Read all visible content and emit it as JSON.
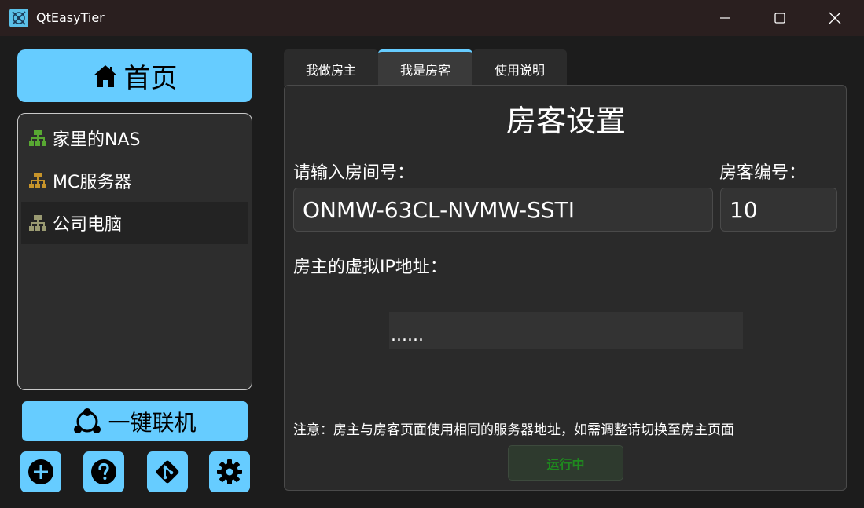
{
  "window": {
    "title": "QtEasyTier"
  },
  "sidebar": {
    "home_label": "首页",
    "devices": [
      {
        "label": "家里的NAS",
        "icon": "network-icon",
        "color": "#58a832"
      },
      {
        "label": "MC服务器",
        "icon": "network-icon",
        "color": "#c7942a"
      },
      {
        "label": "公司电脑",
        "icon": "network-icon",
        "color": "#9a9a72"
      }
    ],
    "selected_index": 2,
    "connect_label": "一键联机",
    "bottom_buttons": [
      {
        "icon": "add-icon"
      },
      {
        "icon": "help-icon"
      },
      {
        "icon": "git-icon"
      },
      {
        "icon": "gear-icon"
      }
    ]
  },
  "tabs": [
    {
      "label": "我做房主"
    },
    {
      "label": "我是房客"
    },
    {
      "label": "使用说明"
    }
  ],
  "active_tab": 1,
  "guest": {
    "title": "房客设置",
    "room_label": "请输入房间号：",
    "room_value": "ONMW-63CL-NVMW-SSTI",
    "guest_no_label": "房客编号：",
    "guest_no_value": "10",
    "host_ip_label": "房主的虚拟IP地址：",
    "host_ip_value": "......",
    "note": "注意：房主与房客页面使用相同的服务器地址，如需调整请切换至房主页面",
    "run_label": "运行中"
  },
  "colors": {
    "accent": "#66ccff",
    "run_text": "#1f8a1f"
  }
}
